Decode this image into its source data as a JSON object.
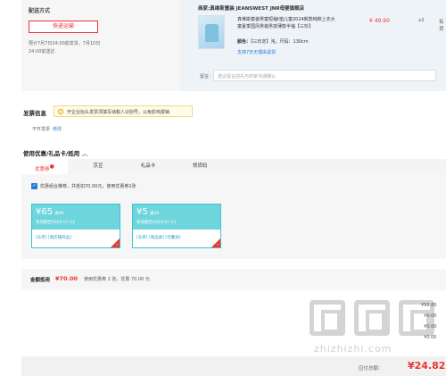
{
  "delivery": {
    "label": "配送方式",
    "method": "快递运输",
    "note_line1": "预计7月7日24:00前发货，7月10日",
    "note_line2": "24:00前送达"
  },
  "order": {
    "shop": "商家:真维斯童装 JEANSWEST JNR母婴旗舰店",
    "product_title": "真维斯童装男童短袖t恤儿童2024新款纯棉上衣大童夏季国风男装男孩薄款半袖【三珍】",
    "spec_label": "颜色：",
    "spec_value": "【三珍定】沌，尺码：130cm",
    "service": "支持7天无理由退货",
    "price": "¥ 49.90",
    "qty": "x2",
    "stock": "有货",
    "message_label": "留言：",
    "message_placeholder": "建议留言前先与商家沟通确认"
  },
  "invoice": {
    "title": "发票信息",
    "tip_icon": "info-icon",
    "tip": "开企业抬头发票须填写纳税人识别号，以免影响报销",
    "state": "不开发票",
    "modify": "修改"
  },
  "coupons": {
    "title": "使用优惠/礼品卡/抵用",
    "chevron": "^",
    "tabs": [
      "优惠券",
      "京豆",
      "礼品卡",
      "领货码"
    ],
    "tab_badge": "●",
    "recommend": "优惠组合推荐，共抵扣70.00元，使用优惠券2张",
    "cards": [
      {
        "amount": "¥65",
        "cond": "满99",
        "expire": "有效期至2024-07-12",
        "tags": "[东券] [限店铺商品]"
      },
      {
        "amount": "¥5",
        "cond": "满39",
        "expire": "有效期至2024-07-15",
        "tags": "[东券] [限品类] [可叠加]"
      }
    ],
    "selected_mark": "✓"
  },
  "amount": {
    "label": "金额抵用",
    "value": "¥70.00",
    "desc": "使用优惠券 2 张，优惠 70.00 元"
  },
  "summary": {
    "lines": [
      "¥99.80",
      "¥0.00",
      "¥0.00",
      "¥0.00"
    ],
    "watermark": "zhizhizhi.com",
    "pay_label": "应付总额：",
    "pay_value": "¥24.82"
  },
  "colors": {
    "accent": "#e33333",
    "coupon": "#6fd5dc",
    "link": "#2a7bd8"
  }
}
